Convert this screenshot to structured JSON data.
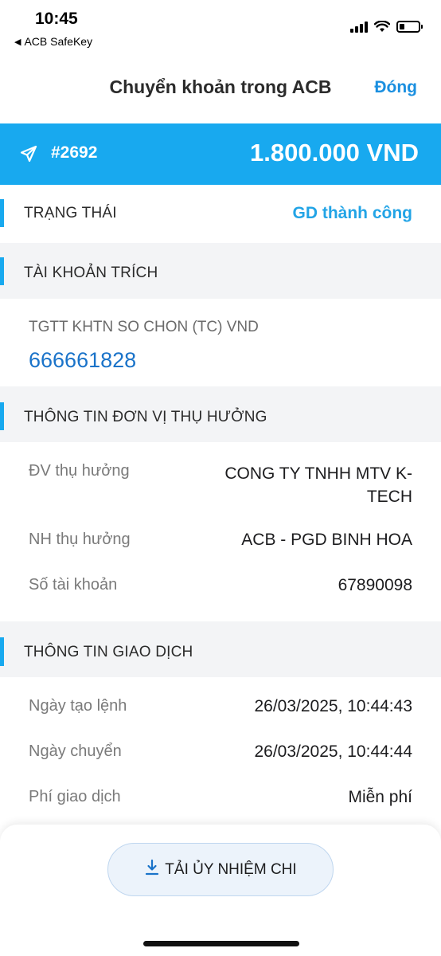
{
  "status_bar": {
    "time": "10:45",
    "back_app": "ACB SafeKey",
    "back_icon": "back-triangle-icon",
    "battery_level": 0.25
  },
  "nav": {
    "title": "Chuyển khoản trong ACB",
    "close_label": "Đóng"
  },
  "banner": {
    "icon": "send-icon",
    "transaction_id": "#2692",
    "amount": "1.800.000 VND",
    "color": "#18a9ef"
  },
  "status_section": {
    "label": "TRẠNG THÁI",
    "value": "GD thành công"
  },
  "source_account": {
    "header": "TÀI KHOẢN TRÍCH",
    "name": "TGTT KHTN SO CHON (TC) VND",
    "number": "666661828"
  },
  "beneficiary": {
    "header": "THÔNG TIN ĐƠN VỊ THỤ HƯỞNG",
    "rows": [
      {
        "label": "ĐV thụ hưởng",
        "value_line1": "CONG TY TNHH MTV K-",
        "value_line2": "TECH"
      },
      {
        "label": "NH thụ hưởng",
        "value": "ACB - PGD BINH HOA"
      },
      {
        "label": "Số tài khoản",
        "value": "67890098"
      }
    ]
  },
  "transaction": {
    "header": "THÔNG TIN GIAO DỊCH",
    "rows": [
      {
        "label": "Ngày tạo lệnh",
        "value": "26/03/2025, 10:44:43"
      },
      {
        "label": "Ngày chuyển",
        "value": "26/03/2025, 10:44:44"
      },
      {
        "label": "Phí giao dịch",
        "value": "Miễn phí"
      }
    ]
  },
  "footer": {
    "download_label": "TẢI ỦY NHIỆM CHI",
    "download_icon": "download-icon"
  },
  "colors": {
    "accent": "#18a9ef",
    "link": "#1a73c9",
    "status": "#22a4e6"
  }
}
